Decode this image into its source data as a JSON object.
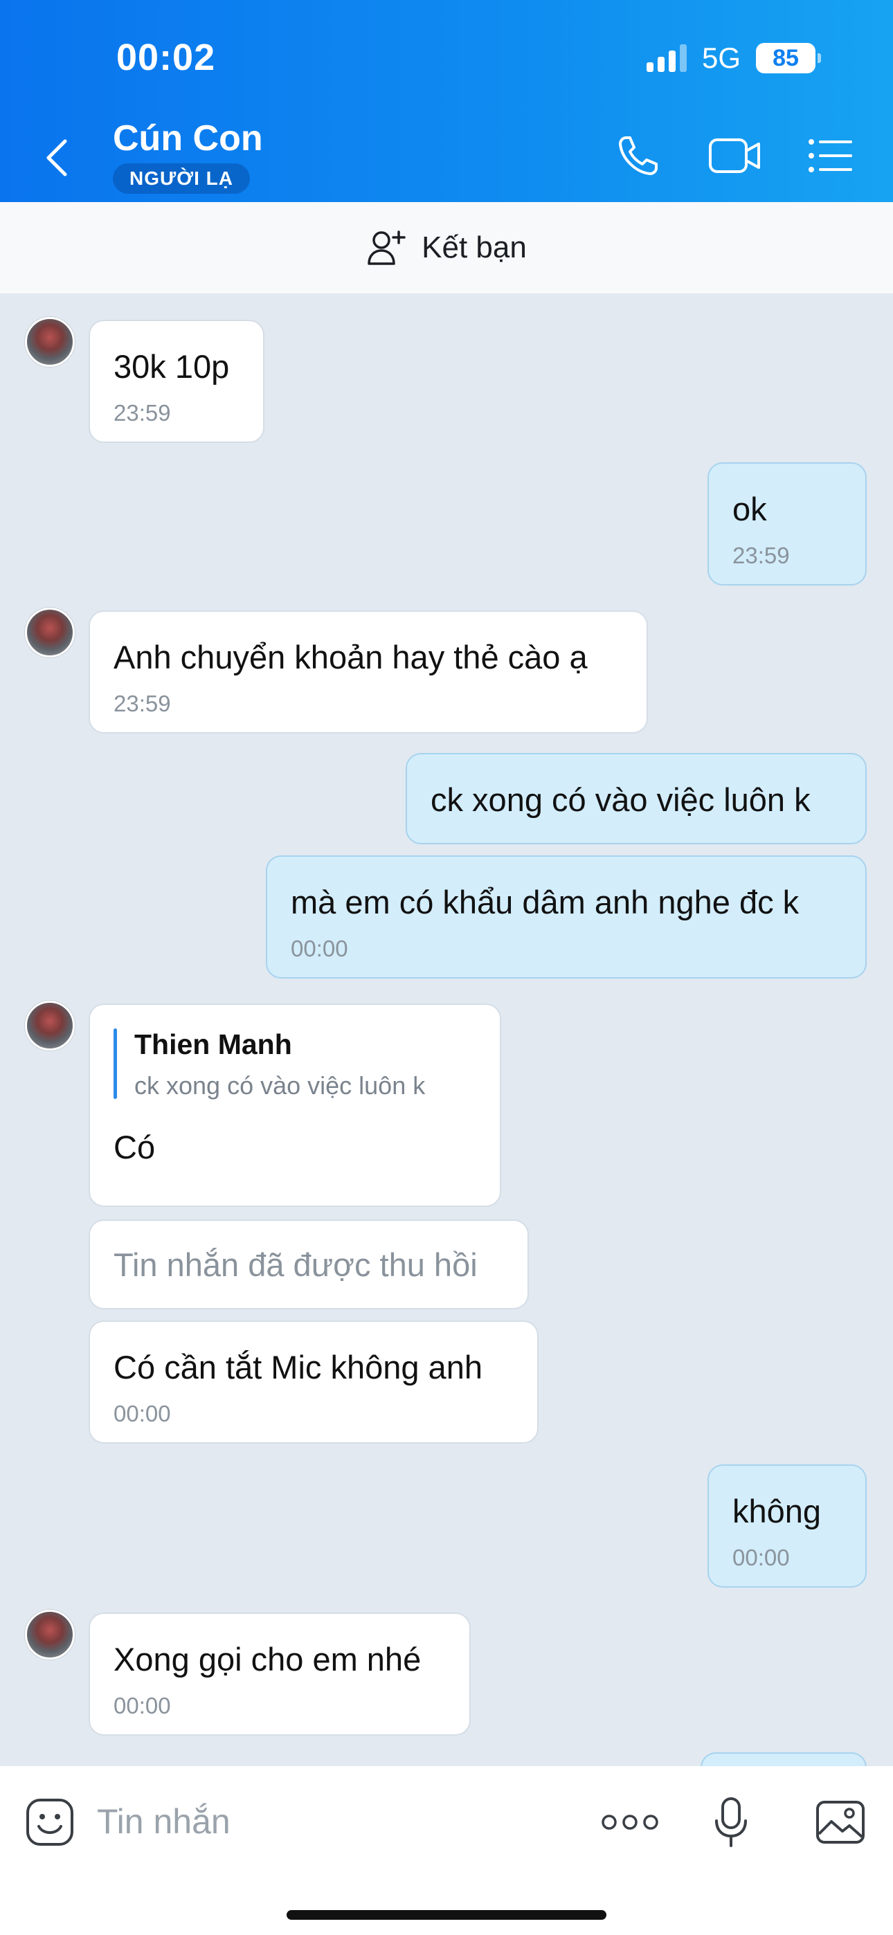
{
  "status_bar": {
    "time": "00:02",
    "network": "5G",
    "battery": "85"
  },
  "header": {
    "title": "Cún Con",
    "badge": "NGƯỜI LẠ",
    "icons": [
      "back-chevron-icon",
      "phone-icon",
      "video-camera-icon",
      "list-menu-icon"
    ],
    "accent_color": "#0a74ee"
  },
  "friend_bar": {
    "label": "Kết bạn",
    "icon": "add-user-icon"
  },
  "messages": [
    {
      "dir": "in",
      "text": "30k 10p",
      "time": "23:59"
    },
    {
      "dir": "out",
      "text": "ok",
      "time": "23:59"
    },
    {
      "dir": "in",
      "text": "Anh chuyển khoản hay thẻ cào ạ",
      "time": "23:59"
    },
    {
      "dir": "out",
      "text": "ck xong có vào việc luôn k",
      "time": ""
    },
    {
      "dir": "out",
      "text": "mà em có khẩu dâm anh nghe đc k",
      "time": "00:00"
    },
    {
      "dir": "in",
      "quote_name": "Thien Manh",
      "quote_text": "ck xong có vào việc luôn k",
      "text": "Có",
      "time": ""
    },
    {
      "dir": "in",
      "text": "Tin nhắn đã được thu hồi",
      "recalled": true,
      "time": ""
    },
    {
      "dir": "in",
      "text": "Có cần tắt Mic không anh",
      "time": "00:00"
    },
    {
      "dir": "out",
      "text": "không",
      "time": "00:00"
    },
    {
      "dir": "in",
      "text": "Xong gọi cho em nhé",
      "time": "00:00"
    }
  ],
  "input_bar": {
    "placeholder": "Tin nhắn",
    "icons": [
      "sticker-icon",
      "more-options-icon",
      "microphone-icon",
      "image-icon"
    ]
  },
  "colors": {
    "incoming_bubble": "#ffffff",
    "outgoing_bubble": "#d3edfb",
    "background": "#e2e9f1"
  }
}
